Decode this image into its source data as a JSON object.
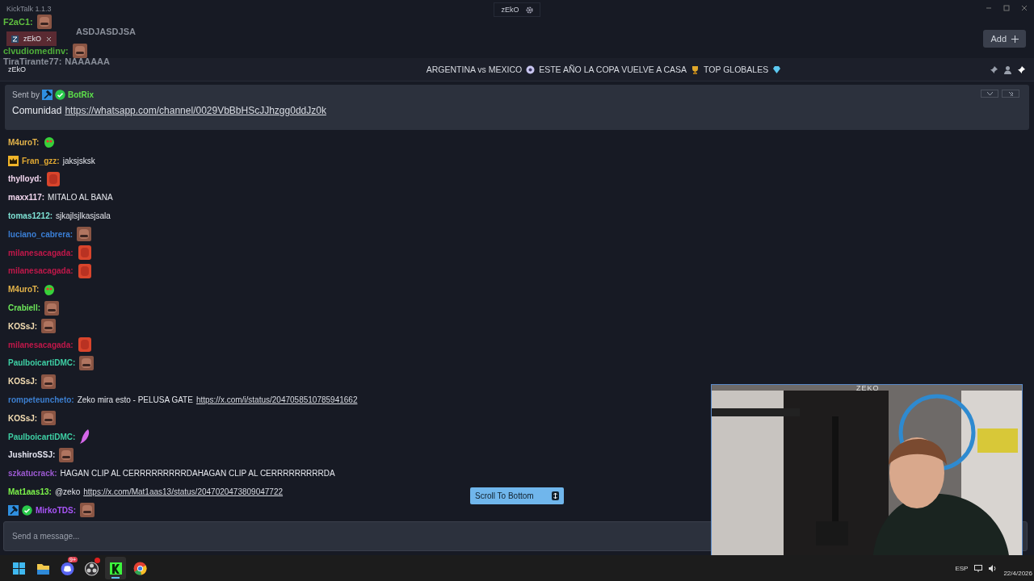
{
  "window": {
    "title": "KickTalk 1.1.3",
    "channel_pill": "zEkO"
  },
  "tabs": [
    {
      "label": "zEkO",
      "selected": true
    }
  ],
  "add_button": "Add",
  "overlay_chat": [
    {
      "user": "F2aC1:",
      "color": "#5fbf3f",
      "emote": {
        "kind": "brown-face"
      }
    },
    {
      "text": "ASDJASDJSA"
    },
    {
      "user": "clvudiomedinv:",
      "color": "#4fae3a",
      "emote": {
        "kind": "brown-face"
      }
    },
    {
      "user": "TiraTirante77:",
      "color": "#8a8f9a",
      "text": "NAAAAAA"
    }
  ],
  "chat_header": {
    "channel": "zEkO",
    "title_parts": [
      {
        "text": "ARGENTINA vs MEXICO",
        "kind": "ball"
      },
      {
        "text": "ESTE AÑO LA COPA VUELVE A CASA",
        "kind": "trophy"
      },
      {
        "text": "TOP GLOBALES",
        "kind": "gem"
      }
    ]
  },
  "pinned": {
    "sent_by": "Sent by",
    "author": "BotRix",
    "text": "Comunidad",
    "link": "https://whatsapp.com/channel/0029VbBbHScJJhzgg0ddJz0k"
  },
  "messages": [
    {
      "user": "M4uroT:",
      "color": "#e3b34a",
      "emote": {
        "kind": "green-blob"
      }
    },
    {
      "user": "Fran_gzz:",
      "color": "#e0a832",
      "badges": [
        {
          "kind": "crown"
        }
      ],
      "text": "jaksjsksk"
    },
    {
      "user": "thylloyd:",
      "color": "#f2d6ee",
      "emote": {
        "kind": "red-face"
      }
    },
    {
      "user": "maxx117:",
      "color": "#f2d6ee",
      "text": "MITALO AL BANA"
    },
    {
      "user": "tomas1212:",
      "color": "#7fe3d6",
      "text": "sjkajlsjlkasjsala"
    },
    {
      "user": "luciano_cabrera:",
      "color": "#3b7fd6",
      "emote": {
        "kind": "brown-face"
      }
    },
    {
      "user": "milanesacagada:",
      "color": "#c0184a",
      "emote": {
        "kind": "red-face"
      }
    },
    {
      "user": "milanesacagada:",
      "color": "#c0184a",
      "emote": {
        "kind": "red-face"
      }
    },
    {
      "user": "M4uroT:",
      "color": "#e3b34a",
      "emote": {
        "kind": "green-blob"
      }
    },
    {
      "user": "Crabiell:",
      "color": "#6ee85a",
      "emote": {
        "kind": "brown-face"
      }
    },
    {
      "user": "KOSsJ:",
      "color": "#f5deb3",
      "emote": {
        "kind": "brown-face"
      }
    },
    {
      "user": "milanesacagada:",
      "color": "#c0184a",
      "emote": {
        "kind": "red-face"
      }
    },
    {
      "user": "PaulboicartiDMC:",
      "color": "#3ecfa4",
      "emote": {
        "kind": "brown-face"
      }
    },
    {
      "user": "KOSsJ:",
      "color": "#f5deb3",
      "emote": {
        "kind": "brown-face"
      }
    },
    {
      "user": "rompeteuncheto:",
      "color": "#3c7fd0",
      "text": "Zeko mira esto - PELUSA GATE",
      "link": "https://x.com/i/status/2047058510785941662"
    },
    {
      "user": "KOSsJ:",
      "color": "#f5deb3",
      "emote": {
        "kind": "brown-face"
      }
    },
    {
      "user": "PaulboicartiDMC:",
      "color": "#3ecfa4",
      "emote": {
        "kind": "purple-feather"
      }
    },
    {
      "user": "JushiroSSJ:",
      "color": "#e4e4f0",
      "emote": {
        "kind": "brown-face"
      }
    },
    {
      "user": "szkatucrack:",
      "color": "#9b59d0",
      "text": "HAGAN CLIP AL CERRRRRRRRRDAHAGAN CLIP AL CERRRRRRRRRDA"
    },
    {
      "user": "Mat1aas13:",
      "color": "#7cf24a",
      "text": "@zeko",
      "link": "https://x.com/Mat1aas13/status/2047020473809047722"
    },
    {
      "user": "MirkoTDS:",
      "color": "#a855f7",
      "badges": [
        {
          "kind": "hammer"
        },
        {
          "kind": "verified"
        }
      ],
      "emote": {
        "kind": "brown-face"
      }
    }
  ],
  "scroll_button": "Scroll To Bottom",
  "input": {
    "placeholder": "Send a message..."
  },
  "webcam": {
    "label": "ZEKO",
    "kind": "picture"
  },
  "taskbar": {
    "apps": [
      {
        "kind": "start",
        "selected": false
      },
      {
        "kind": "folder",
        "selected": false
      },
      {
        "kind": "discord",
        "badge": "9+",
        "selected": false
      },
      {
        "kind": "obs",
        "dot": true,
        "selected": false
      },
      {
        "kind": "kick",
        "selected": true
      },
      {
        "kind": "chrome",
        "selected": false
      }
    ],
    "language": "ESP",
    "date": "22/4/2026"
  }
}
